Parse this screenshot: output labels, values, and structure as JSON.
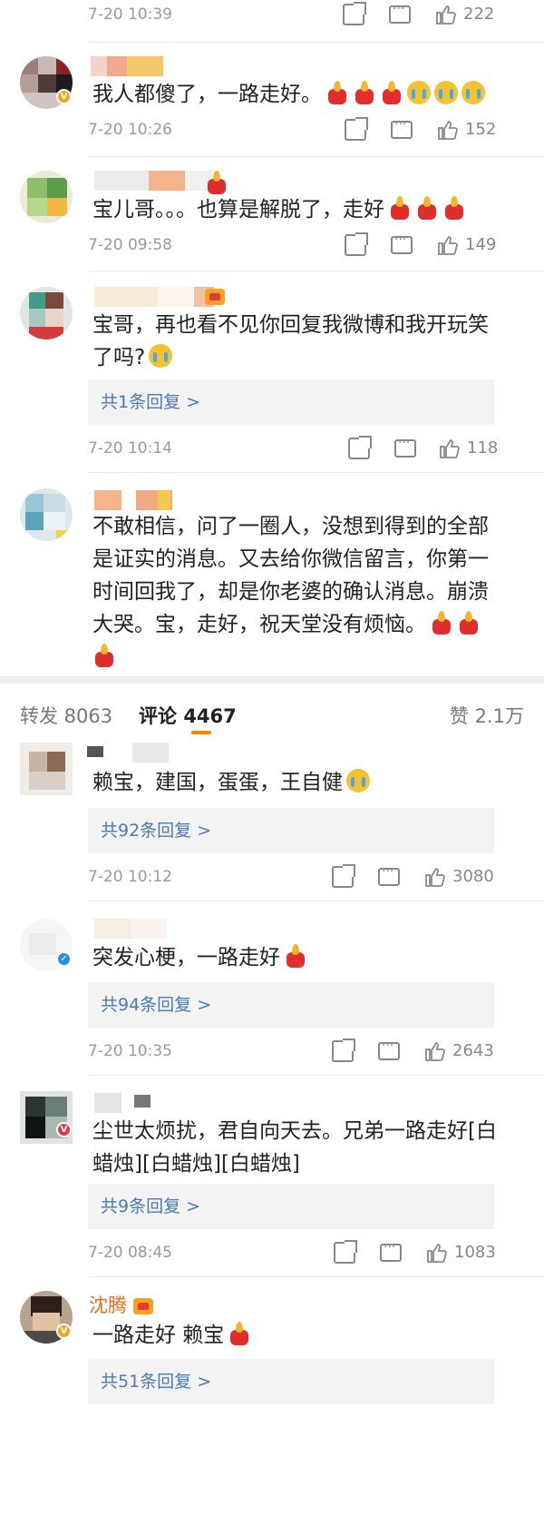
{
  "comments": [
    {
      "id": "c0",
      "time": "7-20 10:39",
      "likes": "222"
    },
    {
      "id": "c1",
      "text": "我人都傻了，一路走好。",
      "time": "7-20 10:26",
      "likes": "152"
    },
    {
      "id": "c2",
      "text": "宝儿哥。。。也算是解脱了，走好",
      "time": "7-20 09:58",
      "likes": "149"
    },
    {
      "id": "c3",
      "text_line1": "宝哥，再也看不见你回复我微博和我开玩笑",
      "text_line2": "了吗?",
      "replies": "共1条回复 >",
      "time": "7-20 10:14",
      "likes": "118"
    },
    {
      "id": "c4",
      "text_line1": "不敢相信，问了一圈人，没想到得到的全部",
      "text_line2": "是证实的消息。又去给你微信留言，你第一",
      "text_line3": "时间回我了，却是你老婆的确认消息。崩溃",
      "text_line4": "大哭。宝，走好，祝天堂没有烦恼。"
    },
    {
      "id": "c5",
      "text": "赖宝，建国，蛋蛋，王自健",
      "replies": "共92条回复 >",
      "time": "7-20 10:12",
      "likes": "3080"
    },
    {
      "id": "c6",
      "text": "突发心梗，一路走好",
      "replies": "共94条回复 >",
      "time": "7-20 10:35",
      "likes": "2643"
    },
    {
      "id": "c7",
      "text_line1": "尘世太烦扰，君自向天去。兄弟一路走好[白",
      "text_line2": "蜡烛][白蜡烛][白蜡烛]",
      "replies": "共9条回复 >",
      "time": "7-20 08:45",
      "likes": "1083"
    },
    {
      "id": "c8",
      "username": "沈腾",
      "text": "一路走好 赖宝",
      "replies": "共51条回复 >"
    }
  ],
  "tabs": {
    "repost": "转发 8063",
    "comments_label": "评论",
    "comments_count": "4467",
    "likes": "赞 2.1万"
  },
  "colors": {
    "accent": "#ff8200",
    "link": "#4a7ab8",
    "username": "#e86d21",
    "meta": "#9a9a9a"
  },
  "icons": [
    "share-icon",
    "comment-icon",
    "thumbs-up-icon",
    "candle-emoji",
    "crying-emoji",
    "vip-crown-icon",
    "verified-badge-icon"
  ]
}
